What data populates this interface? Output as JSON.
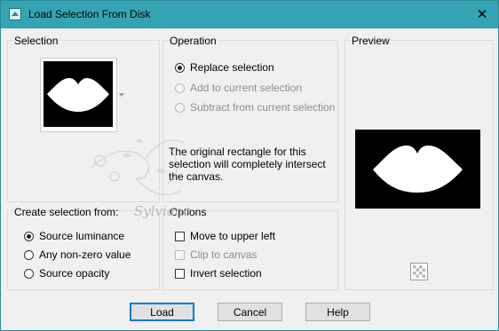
{
  "window": {
    "title": "Load Selection From Disk",
    "close_glyph": "✕"
  },
  "selection": {
    "label": "Selection",
    "thumbnail_icon": "lips-shape-icon"
  },
  "operation": {
    "label": "Operation",
    "options": [
      {
        "label": "Replace selection",
        "checked": true,
        "enabled": true
      },
      {
        "label": "Add to current selection",
        "checked": false,
        "enabled": false
      },
      {
        "label": "Subtract from current selection",
        "checked": false,
        "enabled": false
      }
    ],
    "info": "The original rectangle for this selection will completely intersect the canvas."
  },
  "preview": {
    "label": "Preview",
    "transparency_icon": "checkerboard-icon"
  },
  "create_from": {
    "label": "Create selection from:",
    "options": [
      {
        "label": "Source luminance",
        "checked": true
      },
      {
        "label": "Any non-zero value",
        "checked": false
      },
      {
        "label": "Source opacity",
        "checked": false
      }
    ]
  },
  "options": {
    "label": "Options",
    "items": [
      {
        "label": "Move to upper left",
        "checked": false,
        "enabled": true
      },
      {
        "label": "Clip to canvas",
        "checked": false,
        "enabled": false
      },
      {
        "label": "Invert selection",
        "checked": false,
        "enabled": true
      }
    ]
  },
  "watermark": {
    "text": "Sylviane"
  },
  "buttons": {
    "load": "Load",
    "cancel": "Cancel",
    "help": "Help"
  },
  "colors": {
    "titlebar": "#34a4b4",
    "window_bg": "#f0f0f0",
    "default_button_border": "#0078d7"
  }
}
